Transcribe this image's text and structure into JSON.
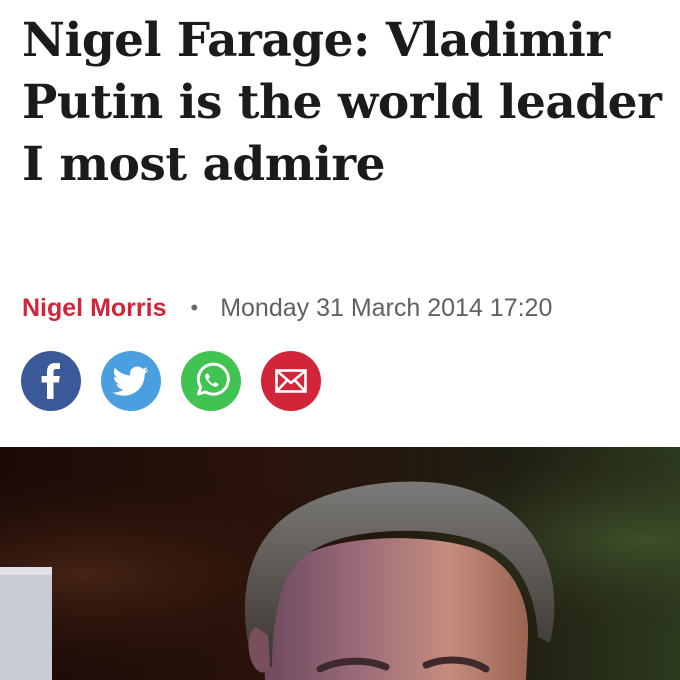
{
  "article": {
    "headline": "Nigel Farage: Vladimir Putin is the world leader I most admire",
    "author": "Nigel Morris",
    "separator": "•",
    "date": "Monday 31 March 2014 17:20"
  },
  "share": [
    {
      "name": "facebook",
      "icon": "facebook-icon",
      "color": "#3b5998"
    },
    {
      "name": "twitter",
      "icon": "twitter-icon",
      "color": "#4a9fe0"
    },
    {
      "name": "whatsapp",
      "icon": "whatsapp-icon",
      "color": "#40c351"
    },
    {
      "name": "email",
      "icon": "email-icon",
      "color": "#d3253a"
    }
  ],
  "colors": {
    "accent": "#d3253a",
    "headline": "#1b1b1b",
    "meta": "#616161"
  }
}
